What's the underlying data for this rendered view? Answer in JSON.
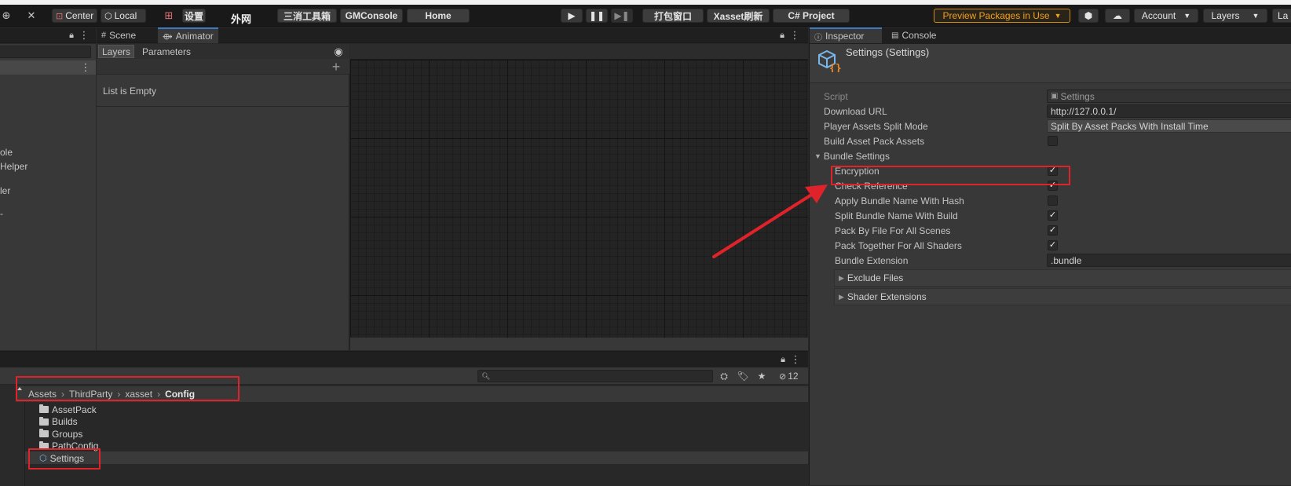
{
  "toolbar": {
    "center": "Center",
    "local": "Local",
    "settings_btn": "设置",
    "network": "外网",
    "tools_btn": "三消工具箱",
    "gmconsole_btn": "GMConsole",
    "home_btn": "Home",
    "pack_window_btn": "打包窗口",
    "xasset_refresh_btn": "Xasset刷新",
    "csharp_project_btn": "C# Project",
    "preview_packages": "Preview Packages in Use",
    "account": "Account",
    "layers": "Layers",
    "layout_partial": "La"
  },
  "hierarchy": {
    "partial_items": [
      "ole",
      "Helper",
      "ler",
      "-"
    ]
  },
  "scene_tabs": {
    "scene": "Scene",
    "animator": "Animator"
  },
  "animator": {
    "layers_tab": "Layers",
    "parameters_tab": "Parameters",
    "add": "+",
    "empty": "List is Empty"
  },
  "inspector": {
    "tab_inspector": "Inspector",
    "tab_console": "Console",
    "title": "Settings (Settings)",
    "script_label": "Script",
    "script_value": "Settings",
    "download_url_label": "Download URL",
    "download_url_value": "http://127.0.0.1/",
    "split_mode_label": "Player Assets Split Mode",
    "split_mode_value": "Split By Asset Packs With Install Time",
    "build_asset_pack_label": "Build Asset Pack Assets",
    "build_asset_pack_checked": false,
    "bundle_settings_label": "Bundle Settings",
    "bundle": [
      {
        "label": "Encryption",
        "checked": true
      },
      {
        "label": "Check Reference",
        "checked": true
      },
      {
        "label": "Apply Bundle Name With Hash",
        "checked": false
      },
      {
        "label": "Split Bundle Name With Build",
        "checked": true
      },
      {
        "label": "Pack By File For All Scenes",
        "checked": true
      },
      {
        "label": "Pack Together For All Shaders",
        "checked": true
      }
    ],
    "bundle_extension_label": "Bundle Extension",
    "bundle_extension_value": ".bundle",
    "exclude_files": "Exclude Files",
    "shader_extensions": "Shader Extensions"
  },
  "project": {
    "breadcrumb": [
      "Assets",
      "ThirdParty",
      "xasset",
      "Config"
    ],
    "hidden_count": "12",
    "items": [
      {
        "name": "AssetPack",
        "type": "folder"
      },
      {
        "name": "Builds",
        "type": "folder"
      },
      {
        "name": "Groups",
        "type": "folder"
      },
      {
        "name": "PathConfig",
        "type": "folder"
      },
      {
        "name": "Settings",
        "type": "asset"
      }
    ]
  },
  "colors": {
    "highlight_red": "#e0222a",
    "accent_blue": "#3a79bb",
    "preview_orange": "#f0a020"
  }
}
